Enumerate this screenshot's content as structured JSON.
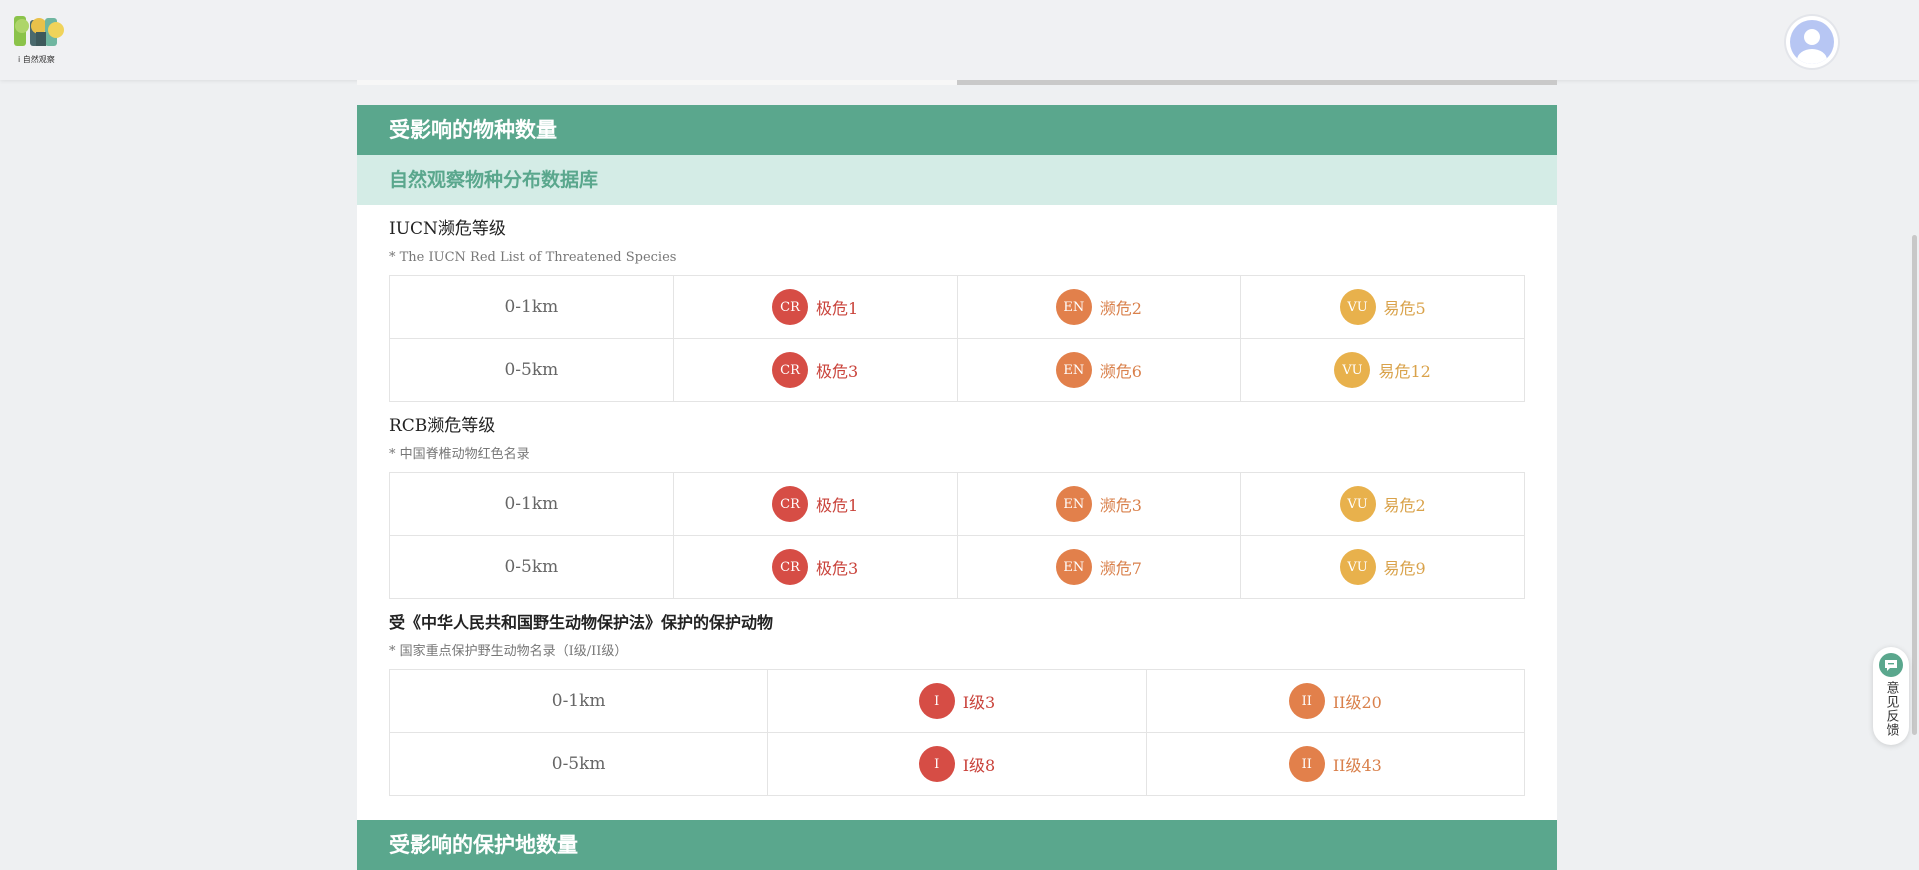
{
  "header": {
    "logo_caption": "i 自然观察"
  },
  "sections": {
    "affected_species_title": "受影响的物种数量",
    "database_title": "自然观察物种分布数据库",
    "affected_protected_areas_title": "受影响的保护地数量"
  },
  "iucn": {
    "title": "IUCN濒危等级",
    "note": "* The IUCN Red List of Threatened Species",
    "rows": [
      {
        "range": "0-1km",
        "cr": {
          "badge": "CR",
          "label": "极危1"
        },
        "en": {
          "badge": "EN",
          "label": "濒危2"
        },
        "vu": {
          "badge": "VU",
          "label": "易危5"
        }
      },
      {
        "range": "0-5km",
        "cr": {
          "badge": "CR",
          "label": "极危3"
        },
        "en": {
          "badge": "EN",
          "label": "濒危6"
        },
        "vu": {
          "badge": "VU",
          "label": "易危12"
        }
      }
    ]
  },
  "rcb": {
    "title": "RCB濒危等级",
    "note": "* 中国脊椎动物红色名录",
    "rows": [
      {
        "range": "0-1km",
        "cr": {
          "badge": "CR",
          "label": "极危1"
        },
        "en": {
          "badge": "EN",
          "label": "濒危3"
        },
        "vu": {
          "badge": "VU",
          "label": "易危2"
        }
      },
      {
        "range": "0-5km",
        "cr": {
          "badge": "CR",
          "label": "极危3"
        },
        "en": {
          "badge": "EN",
          "label": "濒危7"
        },
        "vu": {
          "badge": "VU",
          "label": "易危9"
        }
      }
    ]
  },
  "protected": {
    "title": "受《中华人民共和国野生动物保护法》保护的保护动物",
    "note": "* 国家重点保护野生动物名录（I级/II级）",
    "rows": [
      {
        "range": "0-1km",
        "i": {
          "badge": "I",
          "label": "I级3"
        },
        "ii": {
          "badge": "II",
          "label": "II级20"
        }
      },
      {
        "range": "0-5km",
        "i": {
          "badge": "I",
          "label": "I级8"
        },
        "ii": {
          "badge": "II",
          "label": "II级43"
        }
      }
    ]
  },
  "feedback": {
    "label": "意见反馈"
  },
  "colors": {
    "brand_green": "#5aa78d",
    "light_green": "#d4ece6",
    "cr": "#d64d45",
    "en": "#e2804b",
    "vu": "#e8b14c"
  }
}
